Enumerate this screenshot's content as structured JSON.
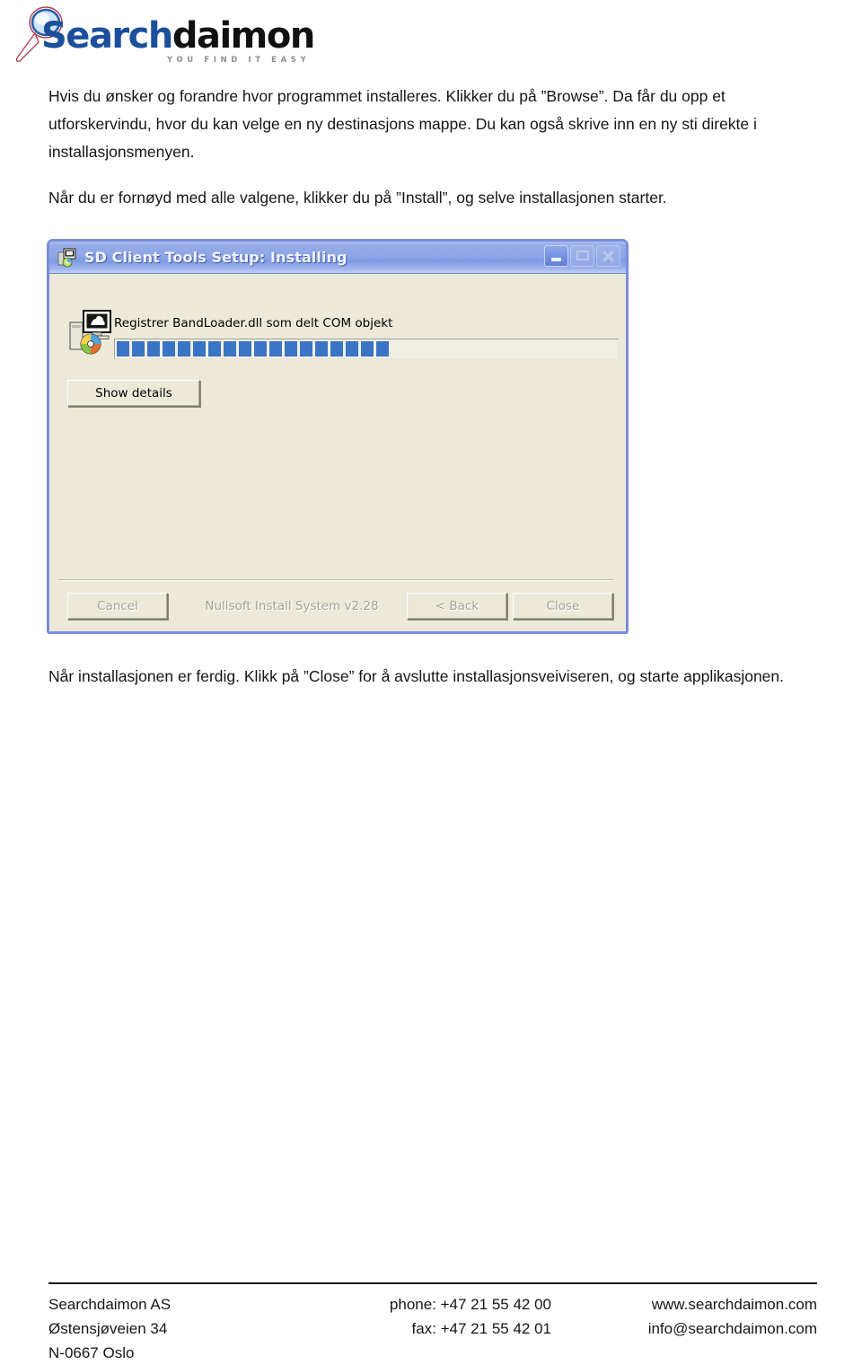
{
  "header": {
    "logo": {
      "word_part_1": "Search",
      "word_part_2": "daimon",
      "tagline": "YOU FIND IT EASY",
      "magnifier_icon": "magnifier-icon"
    }
  },
  "content": {
    "paragraph_1": "Hvis du ønsker og forandre hvor programmet installeres. Klikker du på ”Browse”. Da får du opp et utforskervindu, hvor du kan velge en ny destinasjons mappe. Du kan også skrive inn en ny sti direkte i installasjonsmenyen.",
    "paragraph_2": "Når du er fornøyd med alle valgene, klikker du på ”Install”, og selve installasjonen starter.",
    "paragraph_3": "Når installasjonen er ferdig. Klikk på ”Close” for å avslutte installasjonsveiviseren, og starte applikasjonen."
  },
  "installer": {
    "title": "SD Client Tools Setup: Installing",
    "title_icon": "setup-package-icon",
    "window_buttons": {
      "minimize": "minimize-icon",
      "maximize": "maximize-icon",
      "close": "close-icon"
    },
    "install_icon": "computer-cd-install-icon",
    "status_text": "Registrer BandLoader.dll som delt COM objekt",
    "progress": {
      "percent": 55,
      "blocks_filled": 18,
      "blocks_total": 33,
      "fill_color": "#3a74c4",
      "track_color": "#f1efe2"
    },
    "show_details_label": "Show details",
    "footer_buttons": {
      "cancel": "Cancel",
      "back": "< Back",
      "close": "Close"
    },
    "credit": "Nullsoft Install System v2.28"
  },
  "footer": {
    "address": [
      "Searchdaimon AS",
      "Østensjøveien 34",
      "N-0667 Oslo"
    ],
    "phone": [
      "phone: +47 21 55 42 00",
      "fax: +47 21 55 42 01"
    ],
    "web": [
      "www.searchdaimon.com",
      "info@searchdaimon.com"
    ]
  }
}
